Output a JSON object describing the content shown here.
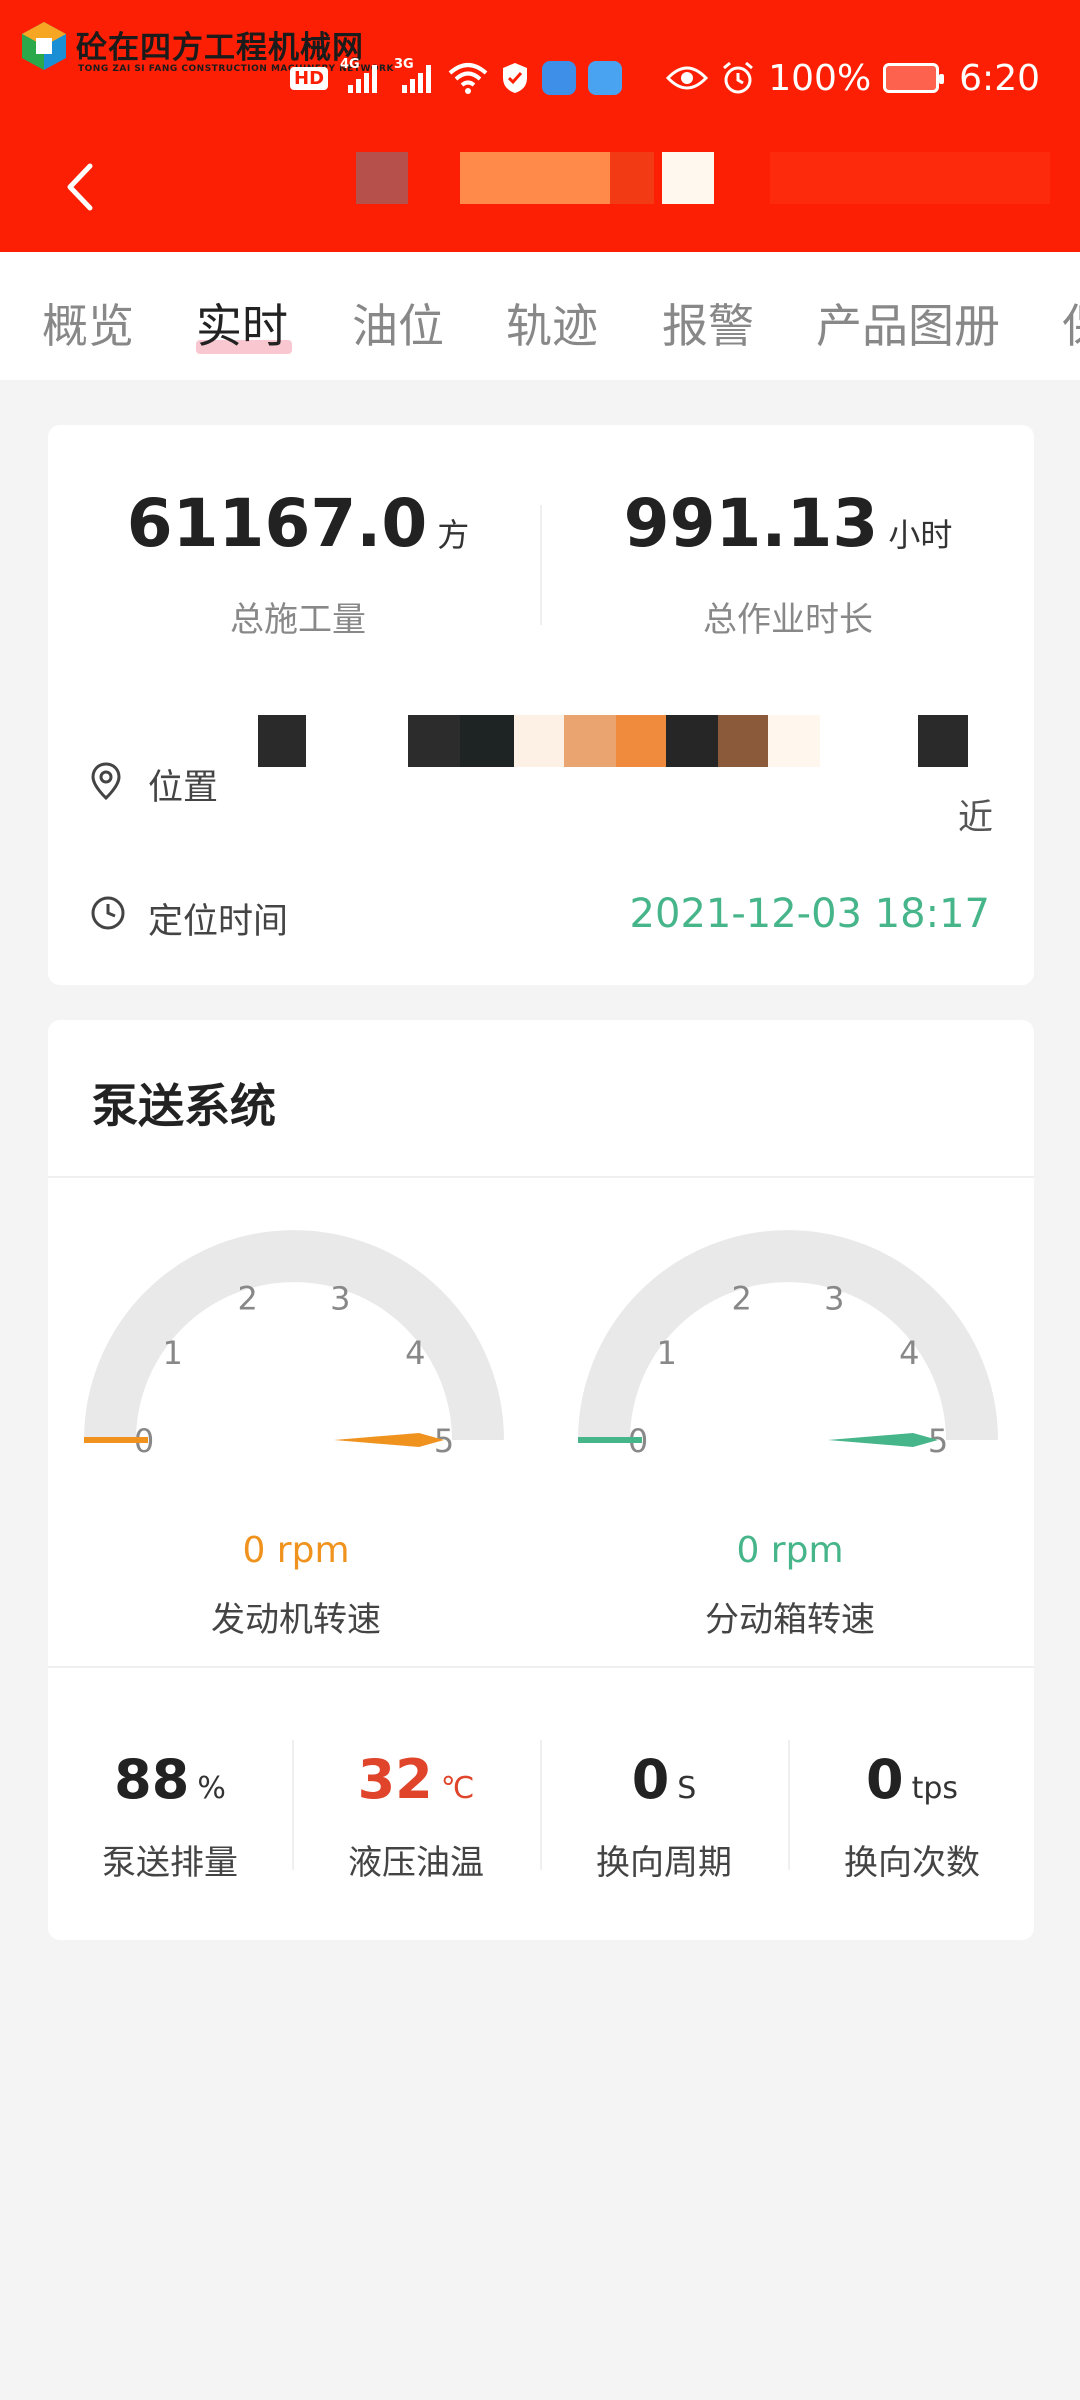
{
  "watermark": {
    "title": "砼在四方工程机械网",
    "subtitle": "TONG ZAI SI FANG CONSTRUCTION MACHINERY NETWORK"
  },
  "status_bar": {
    "hd_badge": "HD",
    "sim1_tech": "4G",
    "sim2_tech": "3G",
    "battery": "100%",
    "time": "6:20"
  },
  "tabs": [
    {
      "label": "概览"
    },
    {
      "label": "实时"
    },
    {
      "label": "油位"
    },
    {
      "label": "轨迹"
    },
    {
      "label": "报警"
    },
    {
      "label": "产品图册"
    },
    {
      "label": "保"
    }
  ],
  "active_tab": "实时",
  "summary": {
    "total_volume": {
      "value": "61167.0",
      "unit": "方",
      "label": "总施工量"
    },
    "total_hours": {
      "value": "991.13",
      "unit": "小时",
      "label": "总作业时长"
    },
    "location_label": "位置",
    "location_tail": "近",
    "positioning_time_label": "定位时间",
    "positioning_time": "2021-12-03 18:17"
  },
  "pump_system": {
    "title": "泵送系统",
    "gauges": [
      {
        "value": "0 rpm",
        "label": "发动机转速",
        "ticks": [
          "0",
          "1",
          "2",
          "3",
          "4",
          "5"
        ],
        "reading": 0,
        "color": "#f0931e"
      },
      {
        "value": "0 rpm",
        "label": "分动箱转速",
        "ticks": [
          "0",
          "1",
          "2",
          "3",
          "4",
          "5"
        ],
        "reading": 0,
        "color": "#46b58a"
      }
    ],
    "metrics": [
      {
        "value": "88",
        "unit": "%",
        "label": "泵送排量",
        "color": "#222222"
      },
      {
        "value": "32",
        "unit": "℃",
        "label": "液压油温",
        "color": "#e0442b"
      },
      {
        "value": "0",
        "unit": "S",
        "label": "换向周期",
        "color": "#222222"
      },
      {
        "value": "0",
        "unit": "tps",
        "label": "换向次数",
        "color": "#222222"
      }
    ]
  },
  "colors": {
    "header_bg": "#fd1f03",
    "accent_green": "#46b58a",
    "accent_orange": "#f0931e",
    "temp_red": "#e0442b"
  }
}
